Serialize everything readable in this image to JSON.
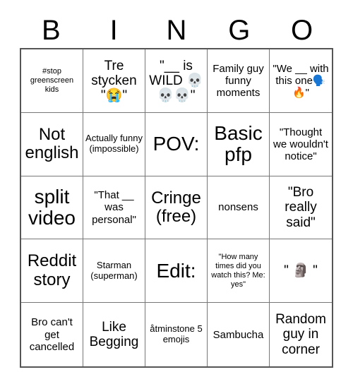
{
  "card": {
    "title": "BINGO",
    "header_letters": [
      "B",
      "I",
      "N",
      "G",
      "O"
    ],
    "background_color": "#ffffff",
    "text_color": "#000000",
    "grid_border_color": "#555555",
    "cell_border_color": "#777777",
    "rows": 5,
    "columns": 5,
    "cells": [
      {
        "text": "#stop greenscreen kids",
        "size": "xs"
      },
      {
        "text": "Tre stycken \"😭\"",
        "size": "l"
      },
      {
        "text": "\"__ is WILD 💀💀💀\"",
        "size": "l"
      },
      {
        "text": "Family guy funny moments",
        "size": "m"
      },
      {
        "text": "\"We __ with this one🗣️🔥\"",
        "size": "m"
      },
      {
        "text": "Not english",
        "size": "xl"
      },
      {
        "text": "Actually funny (impossible)",
        "size": "s"
      },
      {
        "text": "POV:",
        "size": "xxl"
      },
      {
        "text": "Basic pfp",
        "size": "xxl"
      },
      {
        "text": "\"Thought we wouldn't notice\"",
        "size": "m"
      },
      {
        "text": "split video",
        "size": "xxl"
      },
      {
        "text": "\"That __ was personal\"",
        "size": "m"
      },
      {
        "text": "Cringe (free)",
        "size": "xl"
      },
      {
        "text": "nonsens",
        "size": "m"
      },
      {
        "text": "\"Bro really said\"",
        "size": "l"
      },
      {
        "text": "Reddit story",
        "size": "xl"
      },
      {
        "text": "Starman (superman)",
        "size": "s"
      },
      {
        "text": "Edit:",
        "size": "xxl"
      },
      {
        "text": "\"How many times did you watch this? Me: yes\"",
        "size": "xs"
      },
      {
        "text": "\" 🗿 \"",
        "size": "l"
      },
      {
        "text": "Bro can't get cancelled",
        "size": "m"
      },
      {
        "text": "Like Begging",
        "size": "l"
      },
      {
        "text": "åtminstone 5 emojis",
        "size": "s"
      },
      {
        "text": "Sambucha",
        "size": "m"
      },
      {
        "text": "Random guy in corner",
        "size": "l"
      }
    ]
  }
}
